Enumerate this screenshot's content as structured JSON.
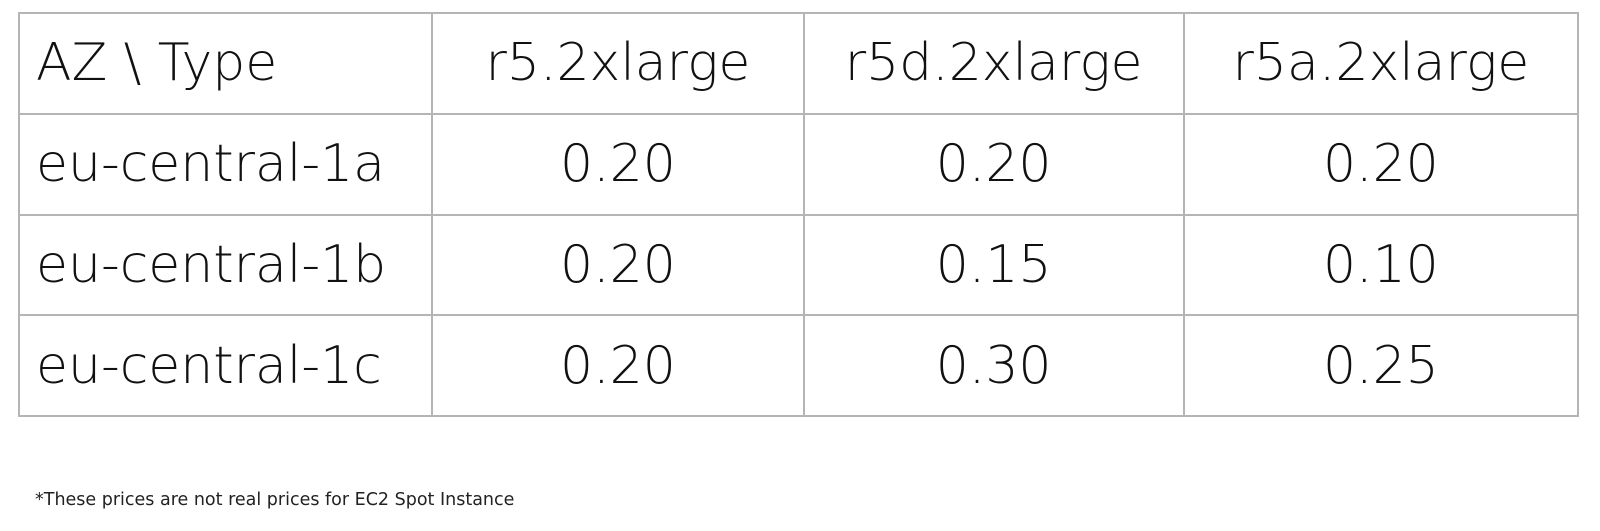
{
  "table": {
    "corner_header": "AZ \\ Type",
    "columns": [
      "r5.2xlarge",
      "r5d.2xlarge",
      "r5a.2xlarge"
    ],
    "rows": [
      {
        "az": "eu-central-1a",
        "values": [
          "0.20",
          "0.20",
          "0.20"
        ]
      },
      {
        "az": "eu-central-1b",
        "values": [
          "0.20",
          "0.15",
          "0.10"
        ]
      },
      {
        "az": "eu-central-1c",
        "values": [
          "0.20",
          "0.30",
          "0.25"
        ]
      }
    ]
  },
  "footnote": "*These prices are not real prices for EC2 Spot Instance",
  "colors": {
    "border": "#b5b5b5",
    "text": "#111111",
    "background": "#ffffff"
  }
}
